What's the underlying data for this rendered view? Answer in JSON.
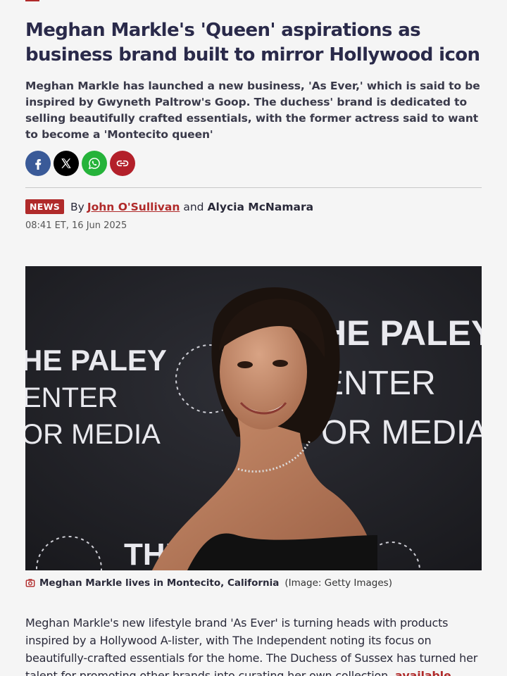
{
  "article": {
    "headline": "Meghan Markle's 'Queen' aspirations as business brand built to mirror Hollywood icon",
    "standfirst": "Meghan Markle has launched a new business, 'As Ever,' which is said to be inspired by Gwyneth Paltrow's Goop. The duchess' brand is dedicated to selling beautifully crafted essentials, with the former actress said to want to become a 'Montecito queen'",
    "share": [
      {
        "icon": "facebook-icon",
        "color": "#3a5a98"
      },
      {
        "icon": "x-icon",
        "color": "#000000"
      },
      {
        "icon": "whatsapp-icon",
        "color": "#25b33a"
      },
      {
        "icon": "copy-link-icon",
        "color": "#b3202a"
      }
    ],
    "badge": "NEWS",
    "by_label": "By",
    "author1": "John O'Sullivan",
    "and_label": "and",
    "author2": "Alycia McNamara",
    "timestamp": "08:41 ET, 16 Jun 2025",
    "image": {
      "caption": "Meghan Markle lives in Montecito, California",
      "credit": "(Image: Getty Images)",
      "backdrop_text": [
        "HE PALEY",
        "ENTER",
        "OR MEDIA",
        "THE P",
        "FOR MEDIA"
      ]
    },
    "body_text": "Meghan Markle's new lifestyle brand 'As Ever' is turning heads with products inspired by a Hollywood A-lister, with The Independent noting its focus on beautifully-crafted essentials for the home. The Duchess of Sussex has turned her talent for promoting other brands into curating her own collection, ",
    "body_link": "available through her exclusive online"
  },
  "colors": {
    "accent": "#b02a2a",
    "headline": "#2a2a4a",
    "background": "#f5f5f5"
  }
}
